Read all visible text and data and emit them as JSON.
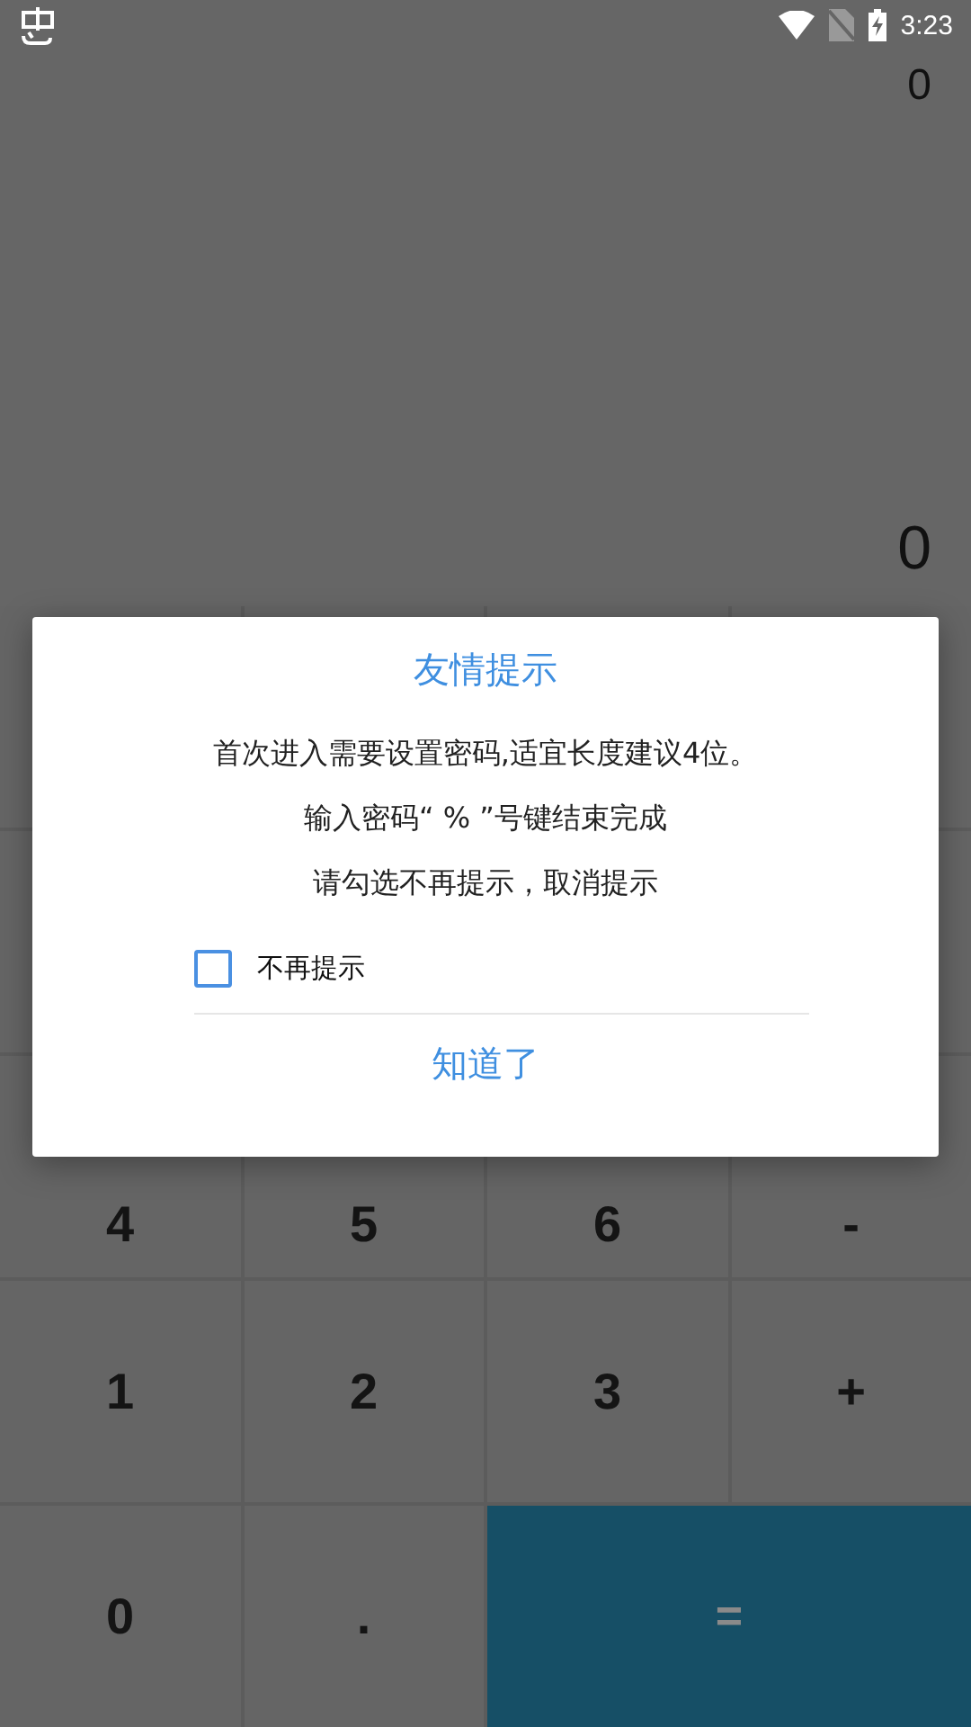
{
  "status_bar": {
    "time": "3:23"
  },
  "display": {
    "expression": "0",
    "result": "0"
  },
  "keypad": {
    "keys": [
      {
        "label": "4",
        "kind": "digit"
      },
      {
        "label": "5",
        "kind": "digit"
      },
      {
        "label": "6",
        "kind": "digit"
      },
      {
        "label": "-",
        "kind": "operator"
      },
      {
        "label": "1",
        "kind": "digit"
      },
      {
        "label": "2",
        "kind": "digit"
      },
      {
        "label": "3",
        "kind": "digit"
      },
      {
        "label": "+",
        "kind": "operator"
      },
      {
        "label": "0",
        "kind": "digit"
      },
      {
        "label": ".",
        "kind": "digit"
      },
      {
        "label": "=",
        "kind": "equals"
      }
    ]
  },
  "dialog": {
    "title": "友情提示",
    "messages": [
      "首次进入需要设置密码,适宜长度建议4位。",
      "输入密码“ % ”号键结束完成",
      "请勾选不再提示，取消提示"
    ],
    "checkbox": {
      "label": "不再提示",
      "checked": false
    },
    "button": "知道了"
  }
}
